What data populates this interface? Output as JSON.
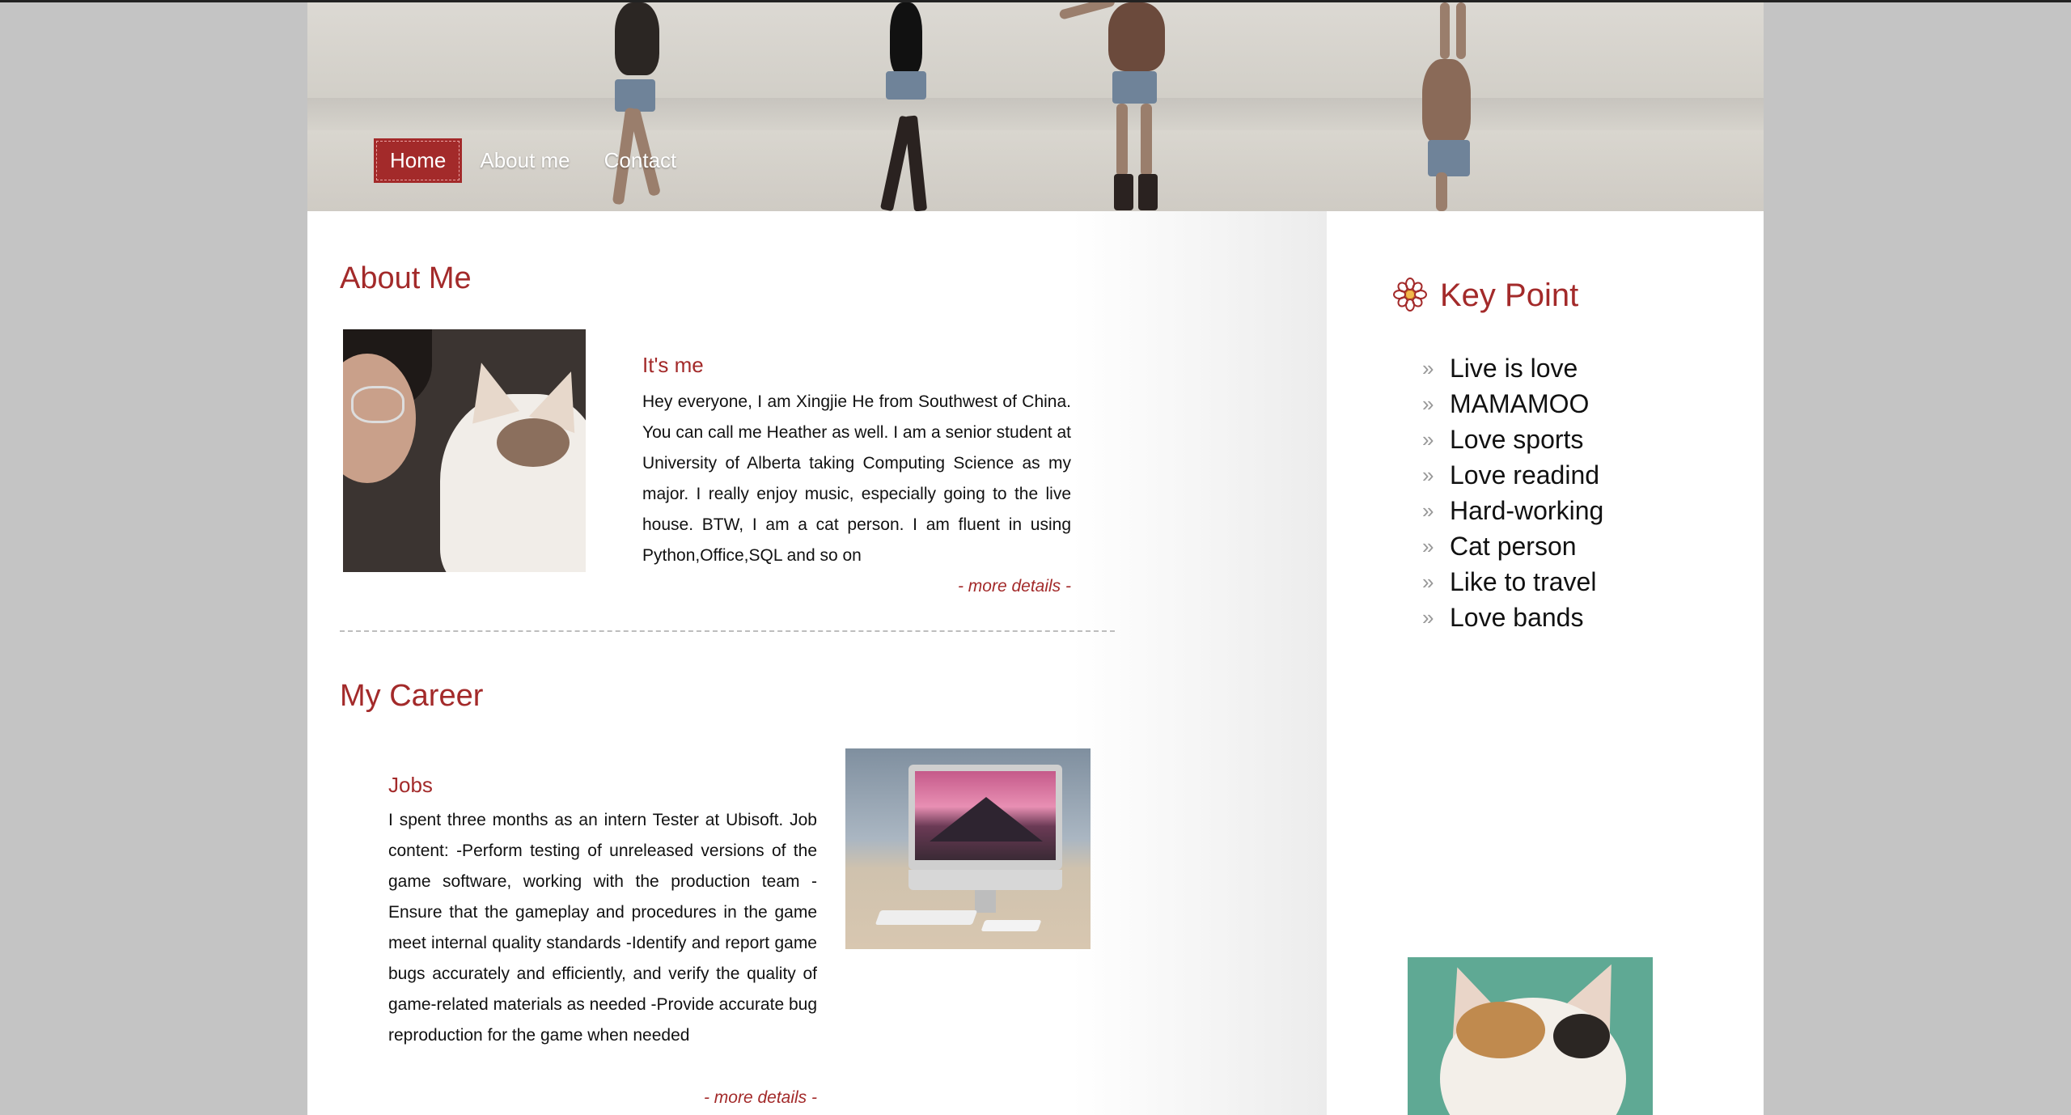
{
  "nav": {
    "items": [
      "Home",
      "About me",
      "Contact"
    ],
    "active": "Home"
  },
  "about": {
    "title": "About Me",
    "subtitle": "It's me",
    "text": "Hey everyone, I am Xingjie He from Southwest of China. You can call me Heather as well. I am a senior student at University of Alberta taking Computing Science as my major. I really enjoy music, especially going to the live house. BTW, I am a cat person. I am fluent in using Python,Office,SQL and so on",
    "more": "- more details -"
  },
  "career": {
    "title": "My Career",
    "subtitle": "Jobs",
    "text": "I spent three months as an intern Tester at Ubisoft. Job content: -Perform testing of unreleased versions of the game software, working with the production team -Ensure that the gameplay and procedures in the game meet internal quality standards -Identify and report game bugs accurately and efficiently, and verify the quality of game-related materials as needed -Provide accurate bug reproduction for the game when needed",
    "more": "- more details -"
  },
  "sidebar": {
    "title": "Key Point",
    "icon": "flower-icon",
    "items": [
      "Live is love",
      "MAMAMOO",
      "Love sports",
      "Love readind",
      "Hard-working",
      "Cat person",
      "Like to travel",
      "Love bands"
    ]
  },
  "colors": {
    "accent": "#a32a2a",
    "page_bg": "#c4c4c4"
  }
}
